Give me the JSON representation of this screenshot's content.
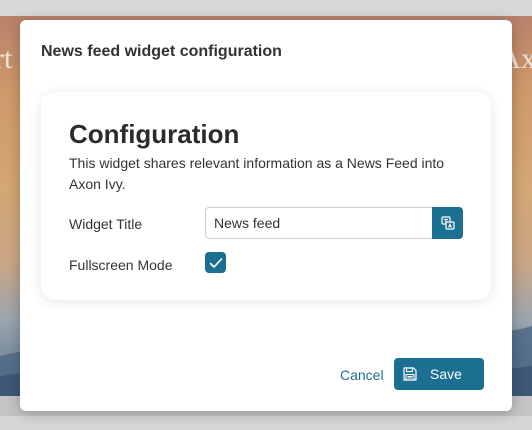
{
  "background": {
    "left_text": "rt",
    "right_text": "Ax"
  },
  "dialog": {
    "title": "News feed widget configuration",
    "card": {
      "heading": "Configuration",
      "description": "This widget shares relevant information as a News Feed into Axon Ivy.",
      "widget_title": {
        "label": "Widget Title",
        "value": "News feed",
        "action_icon": "translate-icon"
      },
      "fullscreen_mode": {
        "label": "Fullscreen Mode",
        "checked": true
      }
    },
    "footer": {
      "cancel_label": "Cancel",
      "save_label": "Save",
      "save_icon": "floppy-disk-icon"
    }
  },
  "colors": {
    "primary": "#1b6f91",
    "text": "#333333",
    "background_banner": "#d4a774"
  }
}
